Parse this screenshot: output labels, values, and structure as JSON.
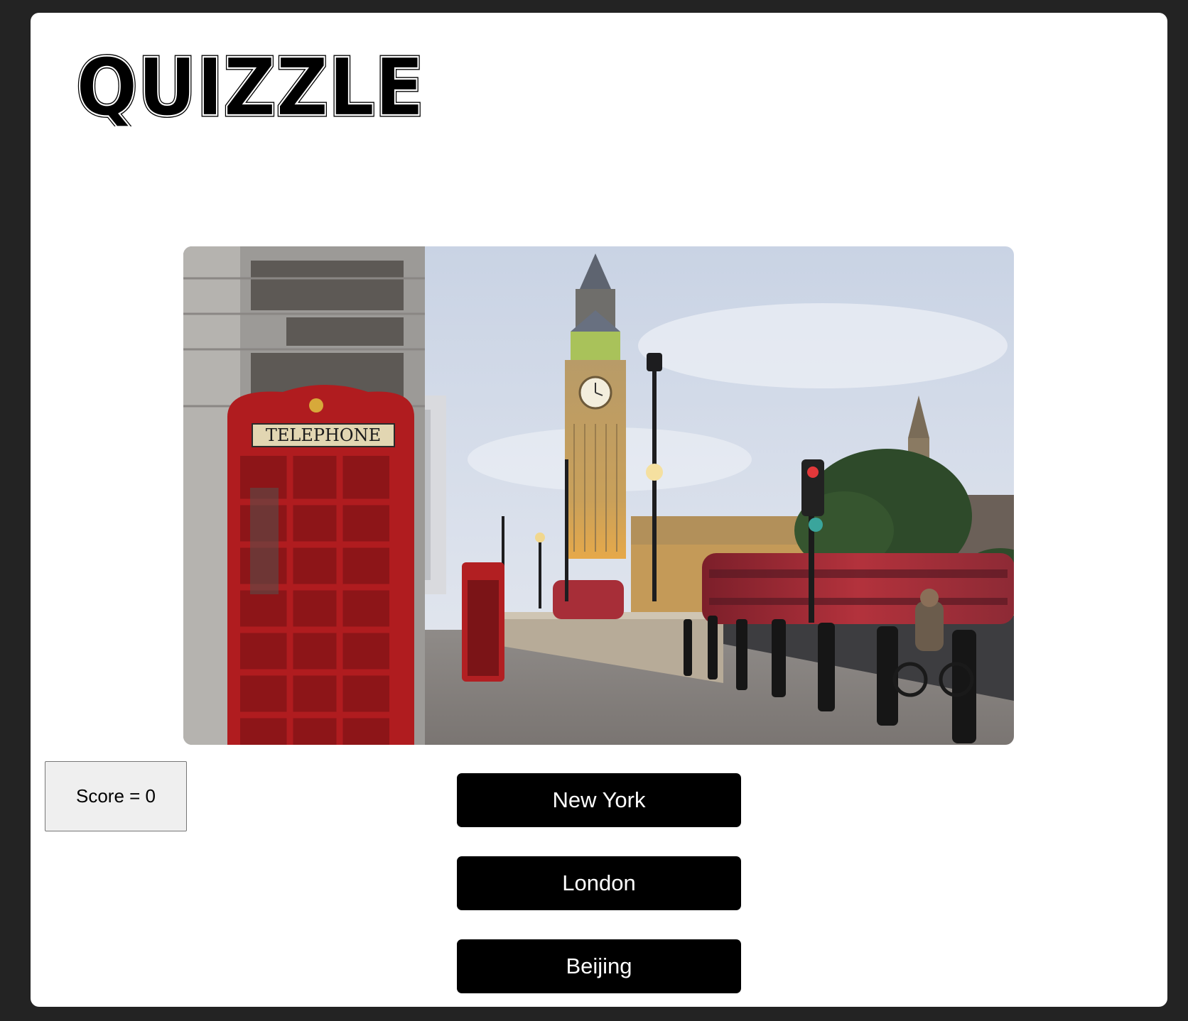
{
  "app": {
    "logo_text": "QUIZZLE"
  },
  "question": {
    "image_label": "photo of a city street with a red telephone box, a clock tower, street lamps and a red double-decker bus"
  },
  "score": {
    "label": "Score = 0",
    "value": 0
  },
  "answers": [
    {
      "label": "New York"
    },
    {
      "label": "London"
    },
    {
      "label": "Beijing"
    }
  ],
  "colors": {
    "page_background": "#232323",
    "card_background": "#ffffff",
    "button_background": "#000000",
    "button_text": "#ffffff",
    "score_background": "#efefef"
  }
}
